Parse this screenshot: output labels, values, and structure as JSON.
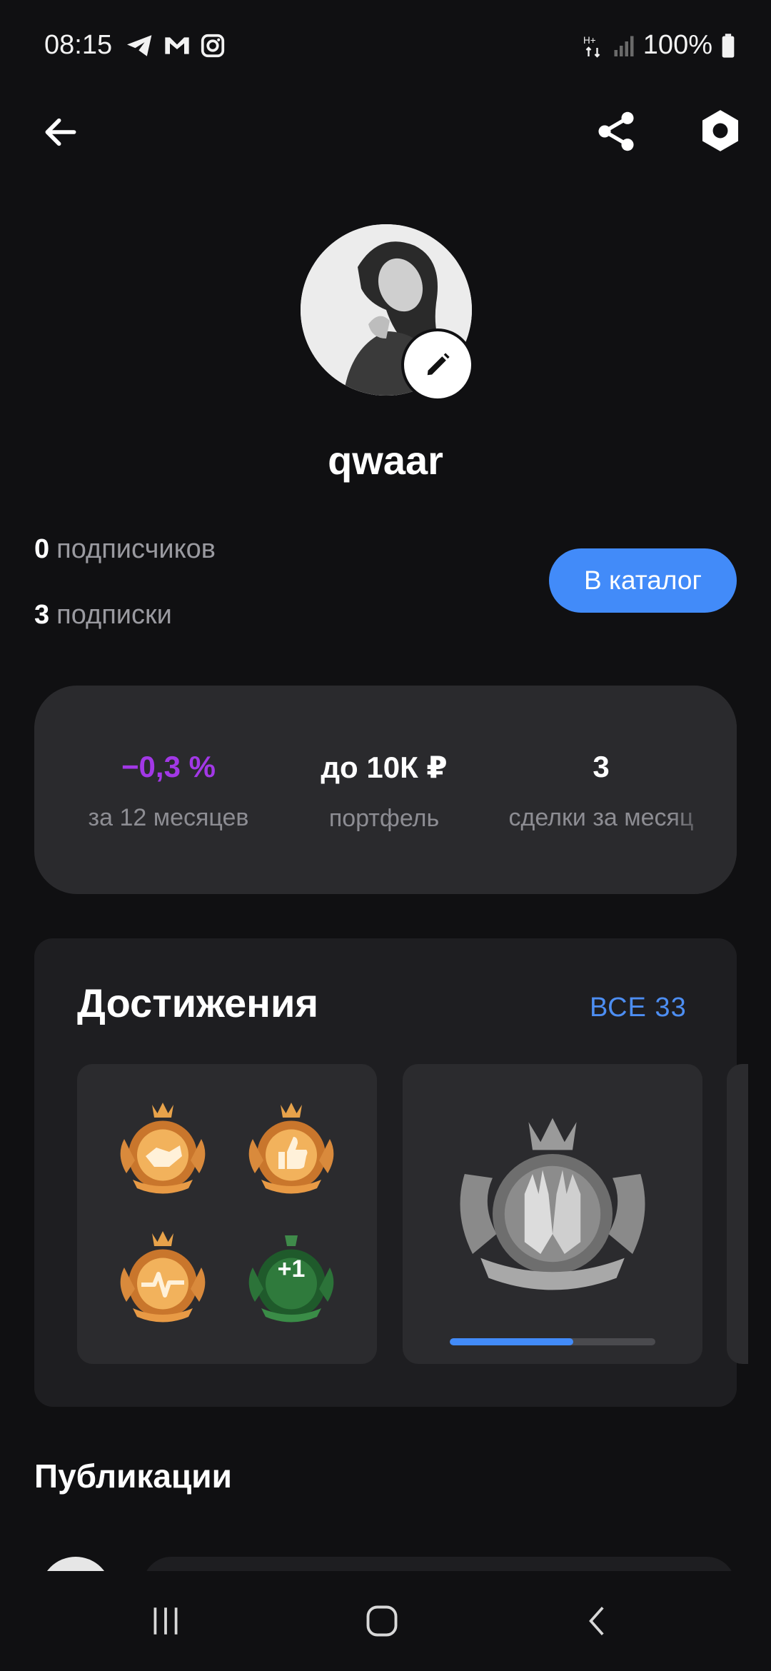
{
  "status_bar": {
    "time": "08:15",
    "battery": "100%"
  },
  "profile": {
    "username": "qwaar",
    "followers_count": "0",
    "followers_label": "подписчиков",
    "following_count": "3",
    "following_label": "подписки",
    "catalog_button": "В каталог"
  },
  "stats": [
    {
      "value": "−0,3 %",
      "label": "за 12 месяцев",
      "color": "#a238e6"
    },
    {
      "value": "до 10К ₽",
      "label": "портфель",
      "color": "#ffffff"
    },
    {
      "value": "3",
      "label": "сделки за месяц",
      "color": "#ffffff"
    }
  ],
  "achievements": {
    "title": "Достижения",
    "all_link": "ВСЕ 33",
    "extra_badge": "+1",
    "progress_fraction": 0.6
  },
  "publications": {
    "title": "Публикации"
  },
  "colors": {
    "accent": "#428bf9",
    "negative_return": "#a238e6",
    "background": "#101012"
  }
}
